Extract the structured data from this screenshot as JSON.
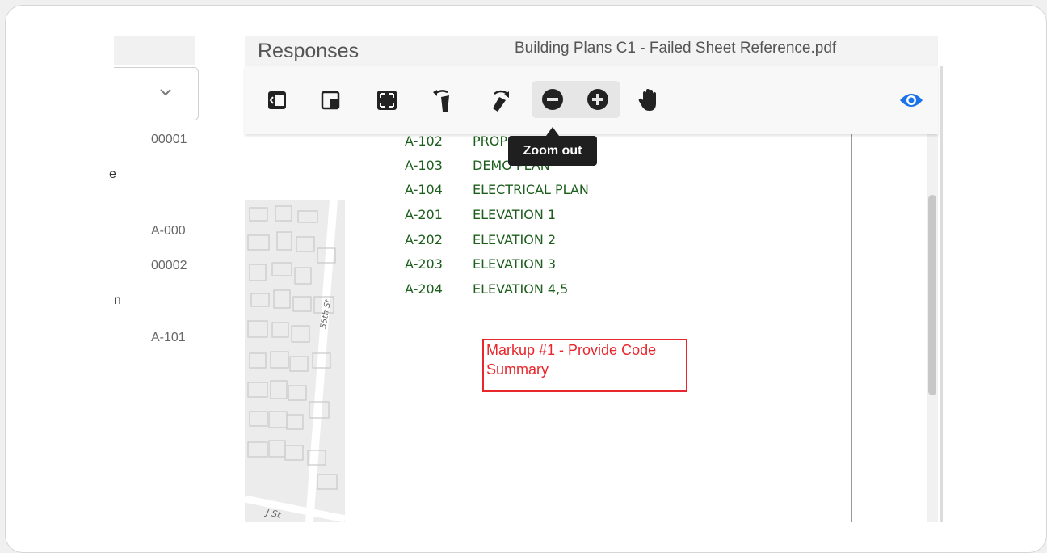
{
  "left_panel": {
    "rows": [
      {
        "number": "00001",
        "label_fragment": "e",
        "sheet": "A-000"
      },
      {
        "number": "00002",
        "label_fragment": "n",
        "sheet": "A-101"
      }
    ]
  },
  "viewer": {
    "responses_title": "Responses",
    "file_name": "Building Plans C1 - Failed Sheet Reference.pdf",
    "toolbar": {
      "tools": [
        "toggle-sidebar-icon",
        "fit-corner-icon",
        "fullscreen-icon",
        "rotate-left-icon",
        "rotate-right-icon",
        "zoom-out-icon",
        "zoom-in-icon",
        "pan-hand-icon",
        "visibility-eye-icon"
      ],
      "accent_color": "#1a73e8"
    },
    "tooltip": "Zoom out",
    "document": {
      "sheets": [
        {
          "code": "A-102",
          "name": "PROPOSED PLAN"
        },
        {
          "code": "A-103",
          "name": "DEMO PLAN"
        },
        {
          "code": "A-104",
          "name": "ELECTRICAL PLAN"
        },
        {
          "code": "A-201",
          "name": "ELEVATION 1"
        },
        {
          "code": "A-202",
          "name": "ELEVATION 2"
        },
        {
          "code": "A-203",
          "name": "ELEVATION 3"
        },
        {
          "code": "A-204",
          "name": "ELEVATION 4,5"
        }
      ],
      "markup_text": "Markup #1 - Provide Code Summary",
      "markup_color": "#e8262b",
      "map_labels": [
        "55th St",
        "J St"
      ]
    }
  }
}
